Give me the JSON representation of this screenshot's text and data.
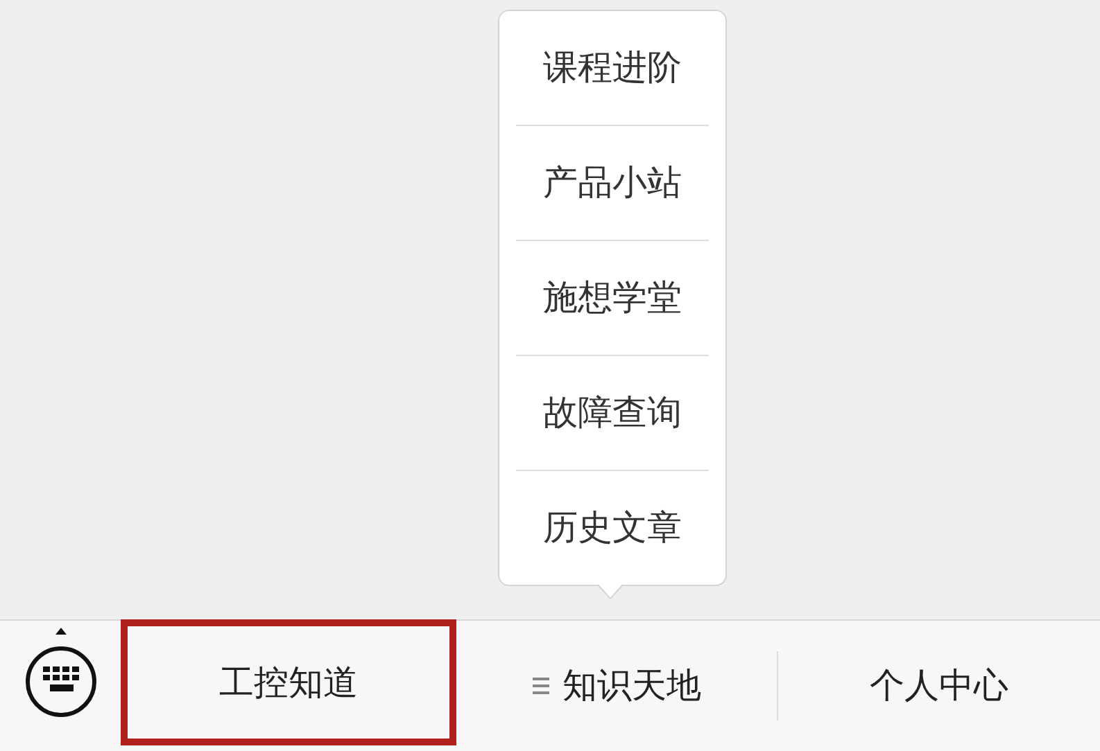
{
  "menu_bar": {
    "items": [
      {
        "label": "工控知道",
        "highlighted": true
      },
      {
        "label": "知识天地",
        "highlighted": false,
        "expanded": true,
        "submenu": [
          "课程进阶",
          "产品小站",
          "施想学堂",
          "故障查询",
          "历史文章"
        ]
      },
      {
        "label": "个人中心",
        "highlighted": false
      }
    ]
  }
}
